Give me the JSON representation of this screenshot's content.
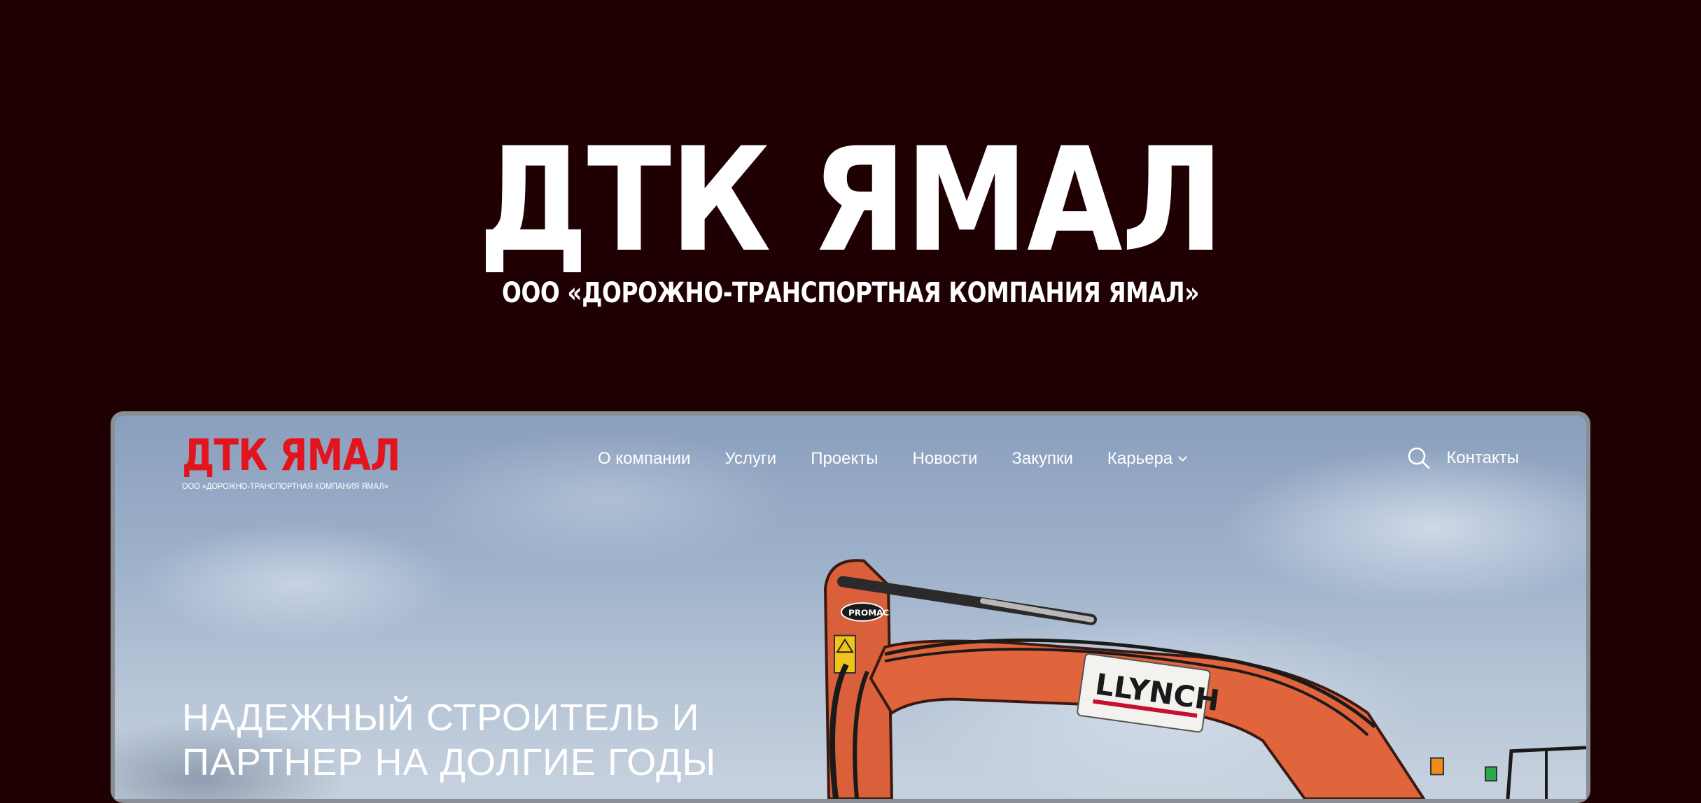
{
  "hero": {
    "title": "ДТК ЯМАЛ",
    "subtitle": "ООО «ДОРОЖНО-ТРАНСПОРТНАЯ КОМПАНИЯ ЯМАЛ»"
  },
  "site": {
    "logo": {
      "title": "ДТК ЯМАЛ",
      "subtitle": "ООО «ДОРОЖНО-ТРАНСПОРТНАЯ КОМПАНИЯ ЯМАЛ»"
    },
    "nav": [
      {
        "label": "О компании"
      },
      {
        "label": "Услуги"
      },
      {
        "label": "Проекты"
      },
      {
        "label": "Новости"
      },
      {
        "label": "Закупки"
      },
      {
        "label": "Карьера",
        "icon": "chevron-down-icon"
      }
    ],
    "search_icon": "search-icon",
    "contacts_label": "Контакты",
    "tagline_line1": "НАДЕЖНЫЙ СТРОИТЕЛЬ И",
    "tagline_line2": "ПАРТНЕР НА ДОЛГИЕ ГОДЫ",
    "excavator": {
      "brand_label": "LLYNCH",
      "badge_label": "PROMAC"
    }
  },
  "colors": {
    "background": "#1f0104",
    "brand_red": "#e2151f",
    "excavator_orange": "#e0643c"
  }
}
